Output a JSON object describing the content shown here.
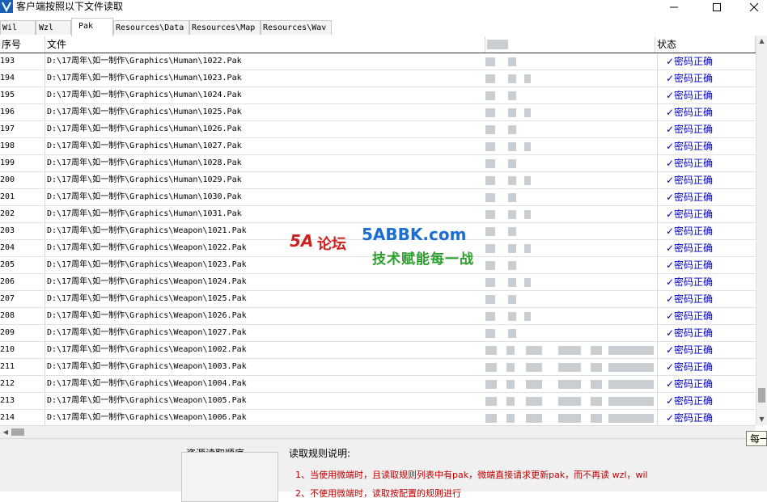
{
  "window": {
    "title": "客户端按照以下文件读取"
  },
  "tabs": [
    {
      "label": "Wil",
      "active": false
    },
    {
      "label": "Wzl",
      "active": false
    },
    {
      "label": "Pak",
      "active": true
    },
    {
      "label": "Resources\\Data",
      "active": false
    },
    {
      "label": "Resources\\Map",
      "active": false
    },
    {
      "label": "Resources\\Wav",
      "active": false
    }
  ],
  "grid": {
    "columns": {
      "no": "序号",
      "file": "文件",
      "status": "状态"
    },
    "rows": [
      {
        "no": "193",
        "file": "D:\\17周年\\如一制作\\Graphics\\Human\\1022.Pak",
        "status": "✓密码正确"
      },
      {
        "no": "194",
        "file": "D:\\17周年\\如一制作\\Graphics\\Human\\1023.Pak",
        "status": "✓密码正确"
      },
      {
        "no": "195",
        "file": "D:\\17周年\\如一制作\\Graphics\\Human\\1024.Pak",
        "status": "✓密码正确"
      },
      {
        "no": "196",
        "file": "D:\\17周年\\如一制作\\Graphics\\Human\\1025.Pak",
        "status": "✓密码正确"
      },
      {
        "no": "197",
        "file": "D:\\17周年\\如一制作\\Graphics\\Human\\1026.Pak",
        "status": "✓密码正确"
      },
      {
        "no": "198",
        "file": "D:\\17周年\\如一制作\\Graphics\\Human\\1027.Pak",
        "status": "✓密码正确"
      },
      {
        "no": "199",
        "file": "D:\\17周年\\如一制作\\Graphics\\Human\\1028.Pak",
        "status": "✓密码正确"
      },
      {
        "no": "200",
        "file": "D:\\17周年\\如一制作\\Graphics\\Human\\1029.Pak",
        "status": "✓密码正确"
      },
      {
        "no": "201",
        "file": "D:\\17周年\\如一制作\\Graphics\\Human\\1030.Pak",
        "status": "✓密码正确"
      },
      {
        "no": "202",
        "file": "D:\\17周年\\如一制作\\Graphics\\Human\\1031.Pak",
        "status": "✓密码正确"
      },
      {
        "no": "203",
        "file": "D:\\17周年\\如一制作\\Graphics\\Weapon\\1021.Pak",
        "status": "✓密码正确"
      },
      {
        "no": "204",
        "file": "D:\\17周年\\如一制作\\Graphics\\Weapon\\1022.Pak",
        "status": "✓密码正确"
      },
      {
        "no": "205",
        "file": "D:\\17周年\\如一制作\\Graphics\\Weapon\\1023.Pak",
        "status": "✓密码正确"
      },
      {
        "no": "206",
        "file": "D:\\17周年\\如一制作\\Graphics\\Weapon\\1024.Pak",
        "status": "✓密码正确"
      },
      {
        "no": "207",
        "file": "D:\\17周年\\如一制作\\Graphics\\Weapon\\1025.Pak",
        "status": "✓密码正确"
      },
      {
        "no": "208",
        "file": "D:\\17周年\\如一制作\\Graphics\\Weapon\\1026.Pak",
        "status": "✓密码正确"
      },
      {
        "no": "209",
        "file": "D:\\17周年\\如一制作\\Graphics\\Weapon\\1027.Pak",
        "status": "✓密码正确"
      },
      {
        "no": "210",
        "file": "D:\\17周年\\如一制作\\Graphics\\Weapon\\1002.Pak",
        "status": "✓密码正确"
      },
      {
        "no": "211",
        "file": "D:\\17周年\\如一制作\\Graphics\\Weapon\\1003.Pak",
        "status": "✓密码正确"
      },
      {
        "no": "212",
        "file": "D:\\17周年\\如一制作\\Graphics\\Weapon\\1004.Pak",
        "status": "✓密码正确"
      },
      {
        "no": "213",
        "file": "D:\\17周年\\如一制作\\Graphics\\Weapon\\1005.Pak",
        "status": "✓密码正确"
      },
      {
        "no": "214",
        "file": "D:\\17周年\\如一制作\\Graphics\\Weapon\\1006.Pak",
        "status": "✓密码正确"
      }
    ]
  },
  "bottom": {
    "order_label": "资源读取顺序",
    "rules_label": "读取规则说明:",
    "rule1": "1、当使用微端时，且读取规则列表中有pak，微端直接请求更新pak，而不再读 wzl，wil",
    "rule2": "2、不使用微端时，读取按配置的规则进行"
  },
  "tooltip": "每一",
  "watermark": {
    "brand_5a": "5A",
    "brand_lt": "论坛",
    "site": "5ABBK.com",
    "slogan": "技术赋能每一战"
  },
  "colors": {
    "status_text": "#0000c8",
    "rule_text": "#c00000",
    "app_icon": "#1a5fb4"
  }
}
